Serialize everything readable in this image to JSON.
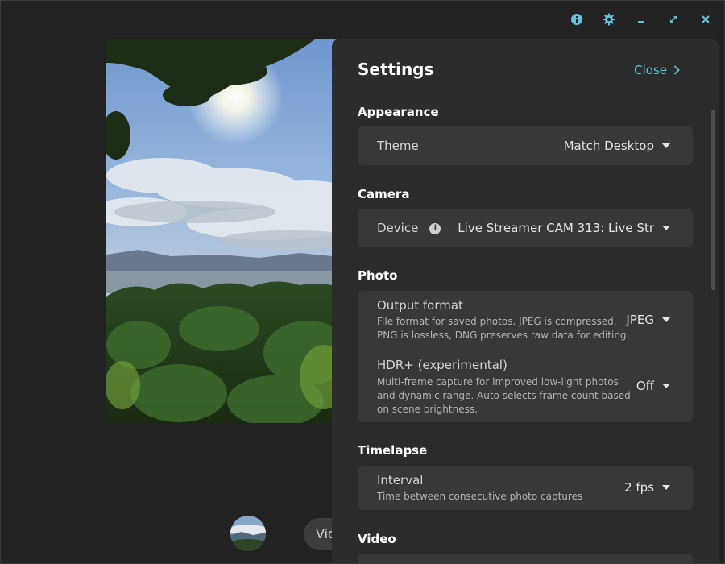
{
  "colors": {
    "accent": "#62c4d6",
    "panel": "#2c2c2c",
    "card": "#383838",
    "window": "#222222"
  },
  "titlebar": {
    "icons": [
      "info-icon",
      "gear-icon",
      "minimize-icon",
      "maximize-icon",
      "close-icon"
    ]
  },
  "bottom": {
    "mode_label": "Video"
  },
  "settings": {
    "title": "Settings",
    "close_label": "Close",
    "appearance": {
      "title": "Appearance",
      "theme_label": "Theme",
      "theme_value": "Match Desktop"
    },
    "camera": {
      "title": "Camera",
      "device_label": "Device",
      "device_value": "Live Streamer CAM 313: Live Str"
    },
    "photo": {
      "title": "Photo",
      "output_label": "Output format",
      "output_desc_1": "File format for saved photos. JPEG is compressed,",
      "output_desc_2": "PNG is lossless, DNG preserves raw data for editing.",
      "output_value": "JPEG",
      "hdr_label": "HDR+ (experimental)",
      "hdr_desc_1": "Multi-frame capture for improved low-light photos",
      "hdr_desc_2": "and dynamic range. Auto selects frame count based",
      "hdr_desc_3": "on scene brightness.",
      "hdr_value": "Off"
    },
    "timelapse": {
      "title": "Timelapse",
      "interval_label": "Interval",
      "interval_desc": "Time between consecutive photo captures",
      "interval_value": "2 fps"
    },
    "video": {
      "title": "Video"
    }
  }
}
